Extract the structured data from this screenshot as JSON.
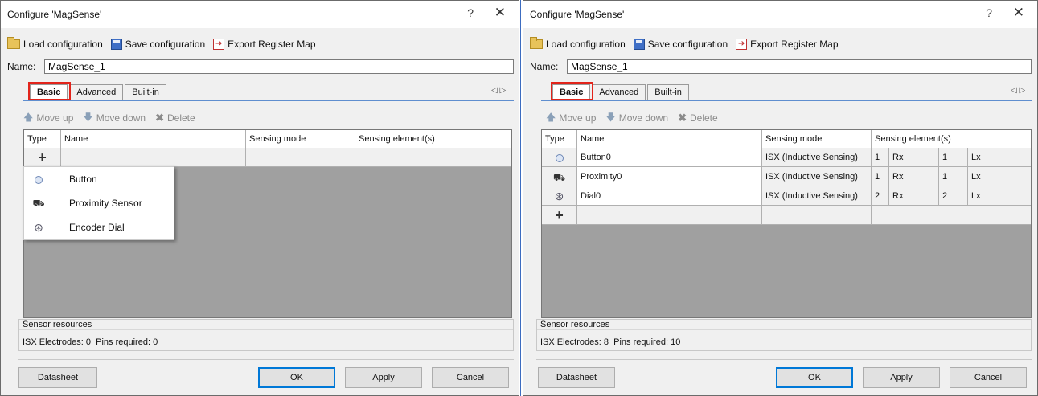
{
  "dialogs": [
    {
      "title": "Configure 'MagSense'",
      "toolbar": {
        "load": "Load configuration",
        "save": "Save configuration",
        "export": "Export Register Map"
      },
      "name_label": "Name:",
      "name_value": "MagSense_1",
      "tabs": [
        "Basic",
        "Advanced",
        "Built-in"
      ],
      "subtoolbar": {
        "move_up": "Move up",
        "move_down": "Move down",
        "delete": "Delete"
      },
      "columns": [
        "Type",
        "Name",
        "Sensing mode",
        "Sensing element(s)"
      ],
      "menu": [
        {
          "icon": "button-icon",
          "label": "Button"
        },
        {
          "icon": "proximity-icon",
          "label": "Proximity Sensor"
        },
        {
          "icon": "encoder-dial-icon",
          "label": "Encoder Dial"
        }
      ],
      "resources": {
        "title": "Sensor resources",
        "electrodes_label": "ISX Electrodes:",
        "electrodes": "0",
        "pins_label": "Pins required:",
        "pins": "0"
      },
      "buttons": {
        "datasheet": "Datasheet",
        "ok": "OK",
        "apply": "Apply",
        "cancel": "Cancel"
      }
    },
    {
      "title": "Configure 'MagSense'",
      "toolbar": {
        "load": "Load configuration",
        "save": "Save configuration",
        "export": "Export Register Map"
      },
      "name_label": "Name:",
      "name_value": "MagSense_1",
      "tabs": [
        "Basic",
        "Advanced",
        "Built-in"
      ],
      "subtoolbar": {
        "move_up": "Move up",
        "move_down": "Move down",
        "delete": "Delete"
      },
      "columns": [
        "Type",
        "Name",
        "Sensing mode",
        "Sensing element(s)"
      ],
      "rows": [
        {
          "icon": "button-icon",
          "name": "Button0",
          "mode": "ISX (Inductive Sensing)",
          "rx_count": "1",
          "rx": "Rx",
          "lx_count": "1",
          "lx": "Lx"
        },
        {
          "icon": "proximity-icon",
          "name": "Proximity0",
          "mode": "ISX (Inductive Sensing)",
          "rx_count": "1",
          "rx": "Rx",
          "lx_count": "1",
          "lx": "Lx"
        },
        {
          "icon": "encoder-dial-icon",
          "name": "Dial0",
          "mode": "ISX (Inductive Sensing)",
          "rx_count": "2",
          "rx": "Rx",
          "lx_count": "2",
          "lx": "Lx"
        }
      ],
      "resources": {
        "title": "Sensor resources",
        "electrodes_label": "ISX Electrodes:",
        "electrodes": "8",
        "pins_label": "Pins required:",
        "pins": "10"
      },
      "buttons": {
        "datasheet": "Datasheet",
        "ok": "OK",
        "apply": "Apply",
        "cancel": "Cancel"
      }
    }
  ],
  "colors": {
    "highlight": "#e2241b",
    "accent": "#0078d7",
    "tab_line": "#5f8ecf"
  }
}
